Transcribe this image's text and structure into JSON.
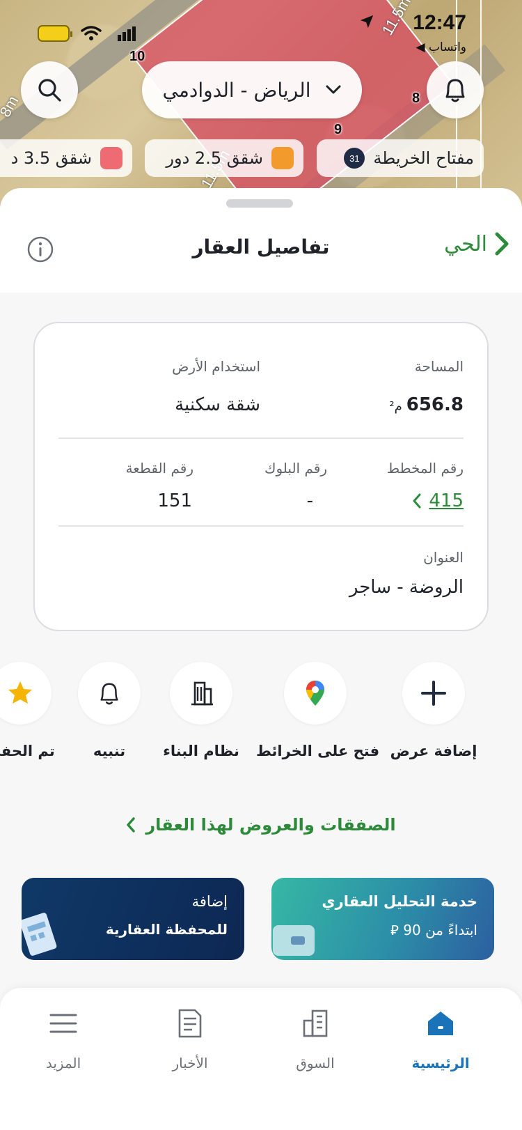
{
  "status_bar": {
    "time": "12:47",
    "back_app": "◀ واتساب"
  },
  "map": {
    "city_select": "الرياض - الدوادمي",
    "labels": [
      "10",
      "8",
      "9"
    ],
    "dims": [
      "11.5m",
      "11.5m",
      "8m"
    ],
    "legend": [
      {
        "label": "مفتاح الخريطة",
        "badge": "31"
      },
      {
        "label": "شقق 2.5 دور",
        "color": "#f39a2d"
      },
      {
        "label": "شقق 3.5 د",
        "color": "#ef6b74"
      }
    ]
  },
  "sheet": {
    "title": "تفاصيل العقار",
    "back": "الحي"
  },
  "details": {
    "area_label": "المساحة",
    "area_value": "656.8",
    "area_unit": "م²",
    "land_use_label": "استخدام الأرض",
    "land_use_value": "شقة سكنية",
    "plan_label": "رقم المخطط",
    "plan_value": "415",
    "block_label": "رقم البلوك",
    "block_value": "-",
    "plot_label": "رقم القطعة",
    "plot_value": "151",
    "address_label": "العنوان",
    "address_value": "الروضة - ساجر"
  },
  "actions": {
    "add_offer": "إضافة عرض",
    "open_maps": "فتح على الخرائط",
    "building_code": "نظام البناء",
    "alert": "تنبيه",
    "saved": "تم الحفظ"
  },
  "deals_link": "الصفقات والعروض لهذا العقار",
  "promos": {
    "analysis_title": "خدمة التحليل العقاري",
    "analysis_sub": "ابتداءً من 90 ⃁",
    "portfolio_top": "إضافة",
    "portfolio_title": "للمحفظة العقارية"
  },
  "tabs": {
    "home": "الرئيسية",
    "market": "السوق",
    "news": "الأخبار",
    "more": "المزيد"
  },
  "colors": {
    "accent_green": "#2d8a3a",
    "active_tab": "#1a73b8",
    "legend_orange": "#f39a2d",
    "legend_red": "#ef6b74"
  }
}
